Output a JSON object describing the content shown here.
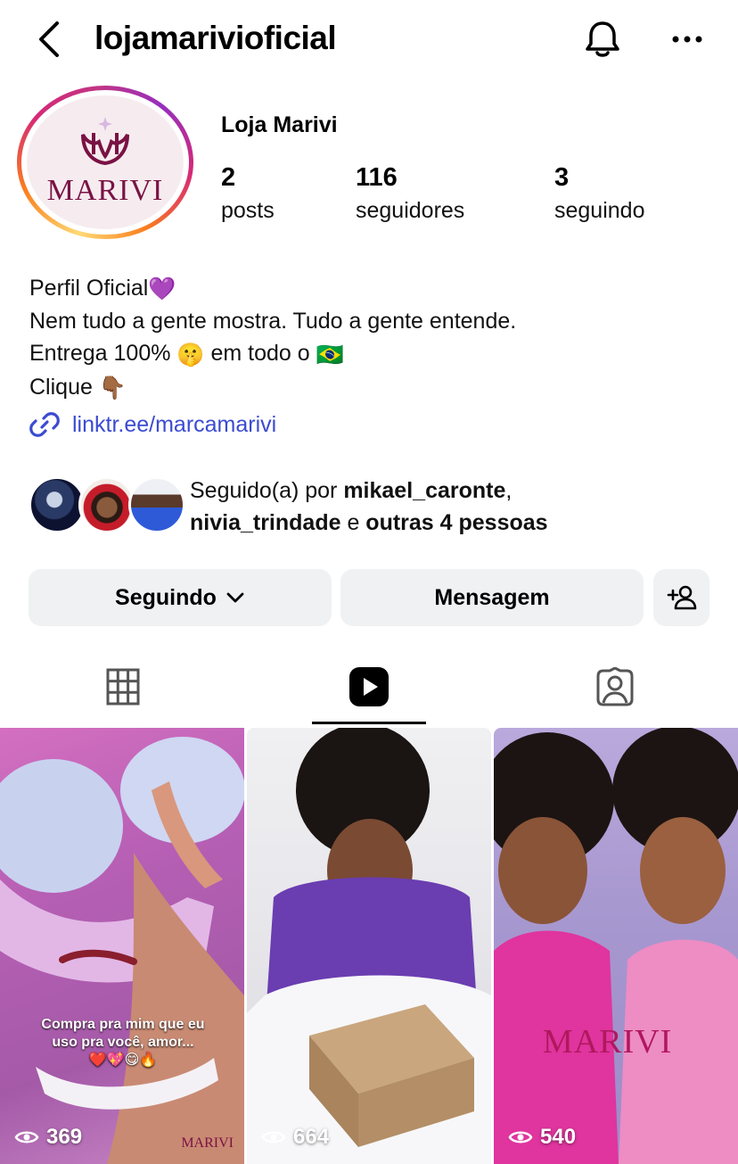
{
  "header": {
    "username": "lojamarivioficial",
    "back_icon": "chevron-left-icon",
    "bell_icon": "bell-icon",
    "more_icon": "more-horizontal-icon"
  },
  "profile": {
    "avatar_logo_text": "MARIVI",
    "display_name": "Loja Marivi",
    "stats": {
      "posts": {
        "value": "2",
        "label": "posts"
      },
      "followers": {
        "value": "116",
        "label": "seguidores"
      },
      "following": {
        "value": "3",
        "label": "seguindo"
      }
    },
    "bio": {
      "line1": "Perfil Oficial",
      "line1_emoji": "💜",
      "line2": "Nem tudo a gente mostra. Tudo a gente entende.",
      "line3_before": "Entrega 100%",
      "line3_emoji1": "🤫",
      "line3_middle": "em todo o",
      "line3_emoji2": "🇧🇷",
      "line4": "Clique",
      "line4_emoji": "👇🏾"
    },
    "link": "linktr.ee/marcamarivi"
  },
  "followed_by": {
    "prefix": "Seguido(a) por ",
    "user1": "mikael_caronte",
    "sep": ",",
    "user2": "nivia_trindade",
    "conj": " e ",
    "others": "outras 4 pessoas"
  },
  "buttons": {
    "following": "Seguindo",
    "message": "Mensagem"
  },
  "tabs": [
    "grid",
    "reels",
    "tagged"
  ],
  "active_tab": "reels",
  "reels": [
    {
      "views": "369",
      "caption": "Compra pra mim que eu uso pra você, amor...",
      "caption_emojis": "❤️💖😋🔥",
      "logo": "MARIVI"
    },
    {
      "views": "664"
    },
    {
      "views": "540",
      "logo": "MARIVI"
    }
  ],
  "colors": {
    "link": "#3b4bd1",
    "button_bg": "#eff1f3",
    "brand": "#7a1244"
  }
}
